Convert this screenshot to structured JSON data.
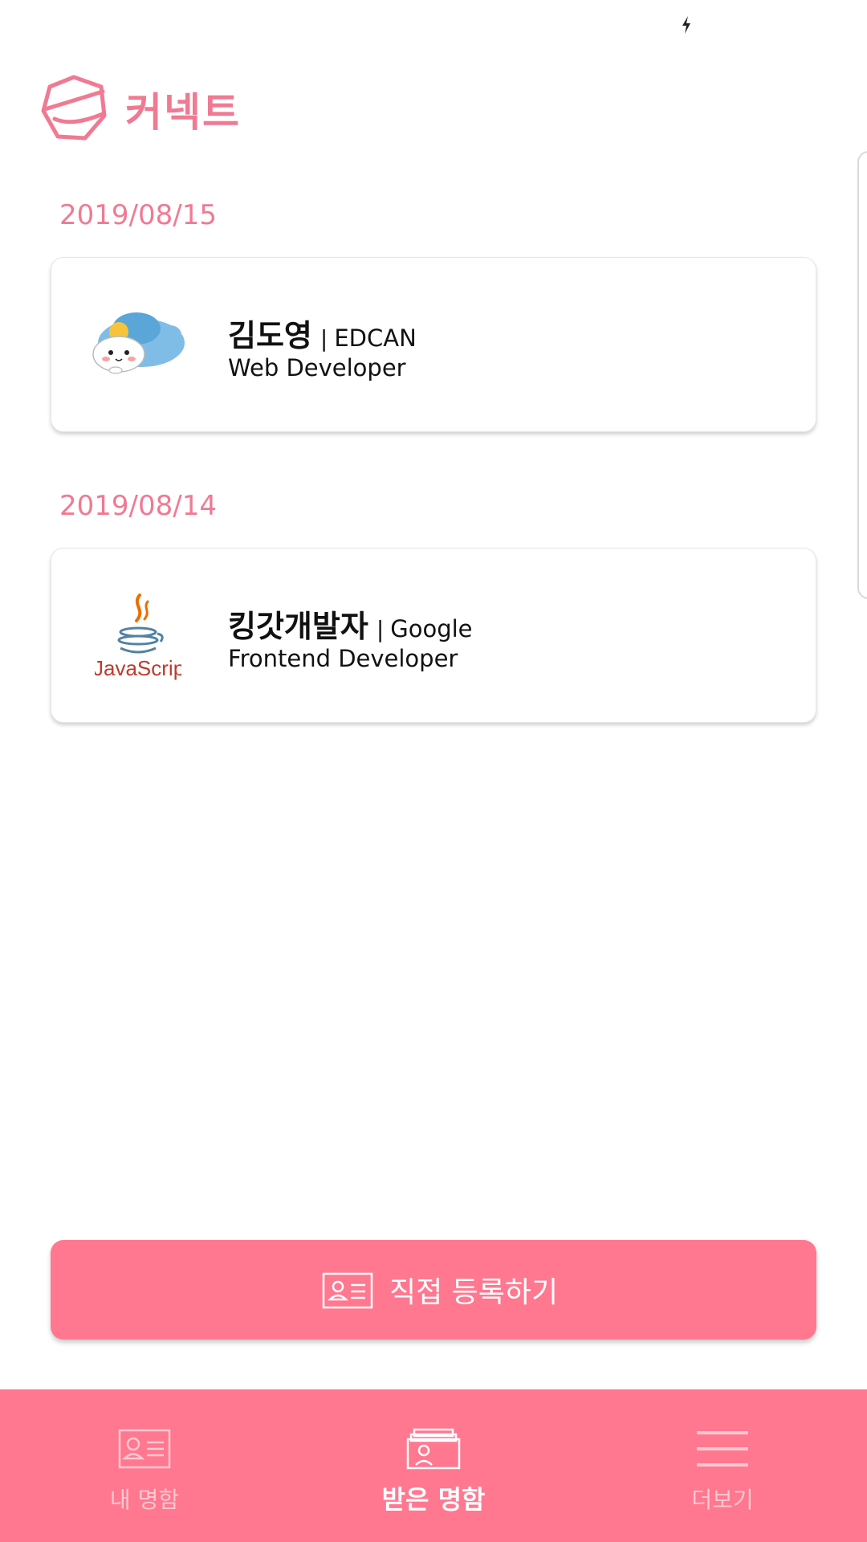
{
  "app": {
    "title": "커넥트",
    "accent_color": "#f07a93",
    "button_color": "#ff7890"
  },
  "status_bar": {
    "icons": [
      "charging-icon"
    ]
  },
  "cards": [
    {
      "date": "2019/08/15",
      "name": "김도영",
      "separator": "|",
      "company": "EDCAN",
      "role": "Web Developer",
      "avatar_icon": "penguin-seal-sticker-icon"
    },
    {
      "date": "2019/08/14",
      "name": "킹갓개발자",
      "separator": "|",
      "company": "Google",
      "role": "Frontend Developer",
      "avatar_icon": "java-coffee-logo-icon",
      "avatar_logo_text": "JavaScript"
    }
  ],
  "register_button": {
    "label": "직접 등록하기",
    "icon": "business-card-icon"
  },
  "bottom_nav": {
    "items": [
      {
        "label": "내 명함",
        "icon": "my-card-icon",
        "active": false
      },
      {
        "label": "받은 명함",
        "icon": "received-cards-icon",
        "active": true
      },
      {
        "label": "더보기",
        "icon": "menu-icon",
        "active": false
      }
    ]
  }
}
